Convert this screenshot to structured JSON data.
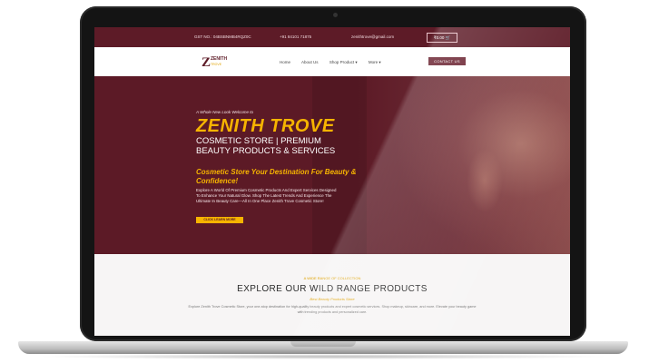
{
  "topbar": {
    "gst": "GST NO.: 04BSBNMB4RQZ0C",
    "phone": "+91 84101 71875",
    "email": "zenithtrove@gmail.com",
    "cart": "₹0.00 🛒"
  },
  "nav": {
    "logo_mark": "Z",
    "logo_name": "ZENITH",
    "logo_sub": "TROVE",
    "links": [
      "Home",
      "About Us",
      "Shop Product ▾",
      "More ▾"
    ],
    "contact": "CONTACT US"
  },
  "hero": {
    "intro": "A Whole New Look Welcome to",
    "title": "ZENITH TROVE",
    "subtitle": "COSMETIC STORE | PREMIUM BEAUTY PRODUCTS & SERVICES",
    "tagline": "Cosmetic Store Your Destination For Beauty & Confidence!",
    "description": "Explore A World Of Premium Cosmetic Products And Expert Services Designed To Enhance Your Natural Glow. Shop The Latest Trends And Experience The Ultimate In Beauty Care—All In One Place Zenith Trove Cosmetic Store!",
    "button": "CLICK LEARN MORE"
  },
  "products": {
    "kicker": "A WIDE RANGE OF COLLECTION",
    "title": "EXPLORE OUR WILD RANGE PRODUCTS",
    "tag": "Best Beauty Products Store",
    "description": "Explore Zenith Trove Cosmetic Store, your one-stop destination for high-quality beauty products and expert cosmetic services. Shop makeup, skincare, and more. Elevate your beauty game with trending products and personalized care."
  }
}
